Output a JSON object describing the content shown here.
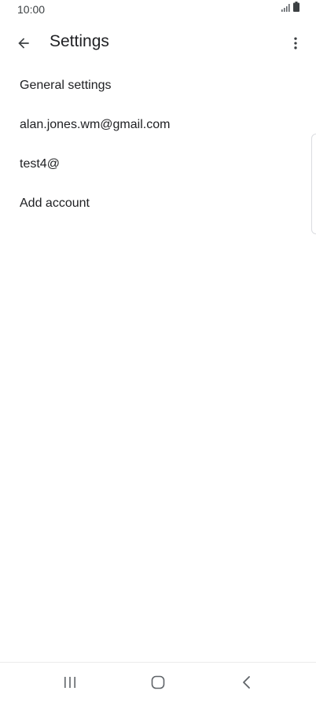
{
  "status_bar": {
    "time": "10:00",
    "icons": [
      "signal-icon",
      "battery-icon"
    ]
  },
  "app_bar": {
    "title": "Settings",
    "back_icon": "arrow-back-icon",
    "more_icon": "more-vert-icon"
  },
  "settings": {
    "items": [
      {
        "label": "General settings"
      },
      {
        "label": "alan.jones.wm@gmail.com"
      },
      {
        "label": "test4@"
      },
      {
        "label": "Add account"
      }
    ]
  },
  "nav_bar": {
    "icons": [
      "recents-icon",
      "home-icon",
      "back-icon"
    ]
  },
  "colors": {
    "text_primary": "#202124",
    "icon": "#5f6368",
    "background": "#ffffff"
  }
}
